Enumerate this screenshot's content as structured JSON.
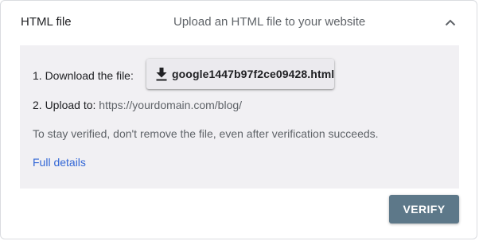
{
  "header": {
    "title": "HTML file",
    "description": "Upload an HTML file to your website",
    "collapse_icon": "chevron-up-icon"
  },
  "steps": {
    "download_label": "1. Download the file:",
    "download_filename": "google1447b97f2ce09428.html",
    "download_icon": "download-icon",
    "upload_label": "2. Upload to:",
    "upload_url": "https://yourdomain.com/blog/"
  },
  "note": "To stay verified, don't remove the file, even after verification succeeds.",
  "details_link": "Full details",
  "verify_button": "VERIFY",
  "colors": {
    "panel_background": "#f1f0f3",
    "link": "#3367d6",
    "verify_button": "#5d7889"
  }
}
